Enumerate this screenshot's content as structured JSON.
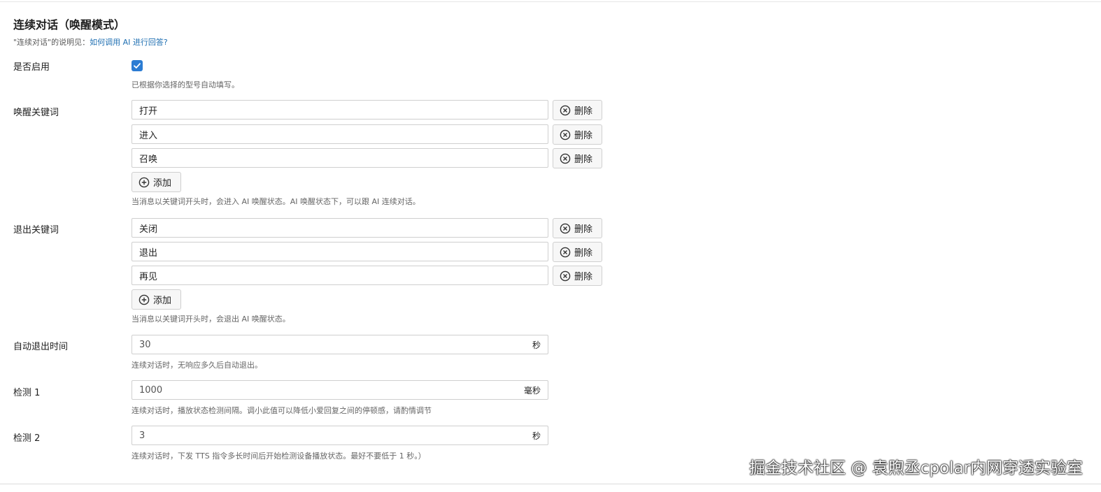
{
  "section": {
    "title": "连续对话（唤醒模式）",
    "desc_prefix": "\"连续对话\"的说明见：",
    "desc_link": "如何调用 AI 进行回答?"
  },
  "enable": {
    "label": "是否启用",
    "checked": true,
    "help": "已根据你选择的型号自动填写。"
  },
  "wake_keywords": {
    "label": "唤醒关键词",
    "items": [
      "打开",
      "进入",
      "召唤"
    ],
    "delete_label": "删除",
    "add_label": "添加",
    "help": "当消息以关键词开头时，会进入 AI 唤醒状态。AI 唤醒状态下，可以跟 AI 连续对话。"
  },
  "exit_keywords": {
    "label": "退出关键词",
    "items": [
      "关闭",
      "退出",
      "再见"
    ],
    "delete_label": "删除",
    "add_label": "添加",
    "help": "当消息以关键词开头时，会退出 AI 唤醒状态。"
  },
  "auto_exit": {
    "label": "自动退出时间",
    "value": "30",
    "unit": "秒",
    "help": "连续对话时，无响应多久后自动退出。"
  },
  "check1": {
    "label": "检测 1",
    "value": "1000",
    "unit": "毫秒",
    "help": "连续对话时，播放状态检测间隔。调小此值可以降低小爱回复之间的停顿感，请酌情调节"
  },
  "check2": {
    "label": "检测 2",
    "value": "3",
    "unit": "秒",
    "help": "连续对话时，下发 TTS 指令多长时间后开始检测设备播放状态。最好不要低于 1 秒。）"
  },
  "watermark": "掘金技术社区 @ 袁煦丞cpolar内网穿透实验室",
  "colors": {
    "accent": "#2b7cd3",
    "link": "#1f6fb2"
  }
}
